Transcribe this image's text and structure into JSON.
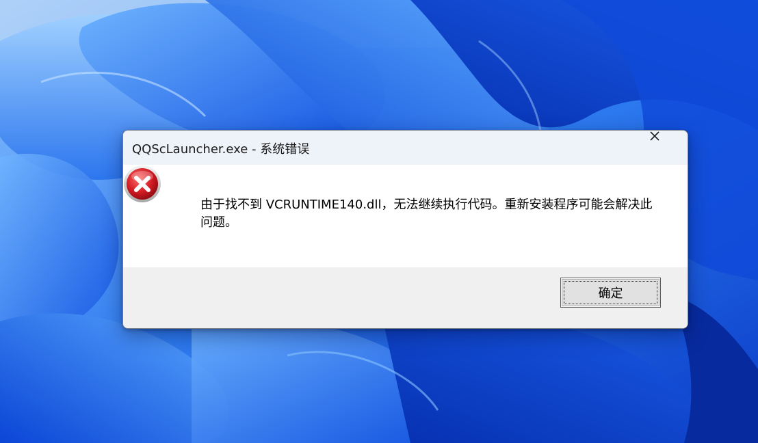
{
  "dialog": {
    "title": "QQScLauncher.exe - 系统错误",
    "message": "由于找不到 VCRUNTIME140.dll，无法继续执行代码。重新安装程序可能会解决此问题。",
    "ok_label": "确定",
    "icon": "error-icon",
    "close_icon": "close-icon"
  },
  "colors": {
    "wallpaper_base": "#3d8cf0",
    "titlebar": "#eef2f9",
    "footer": "#f0f0f0",
    "error_red": "#c8141e"
  }
}
